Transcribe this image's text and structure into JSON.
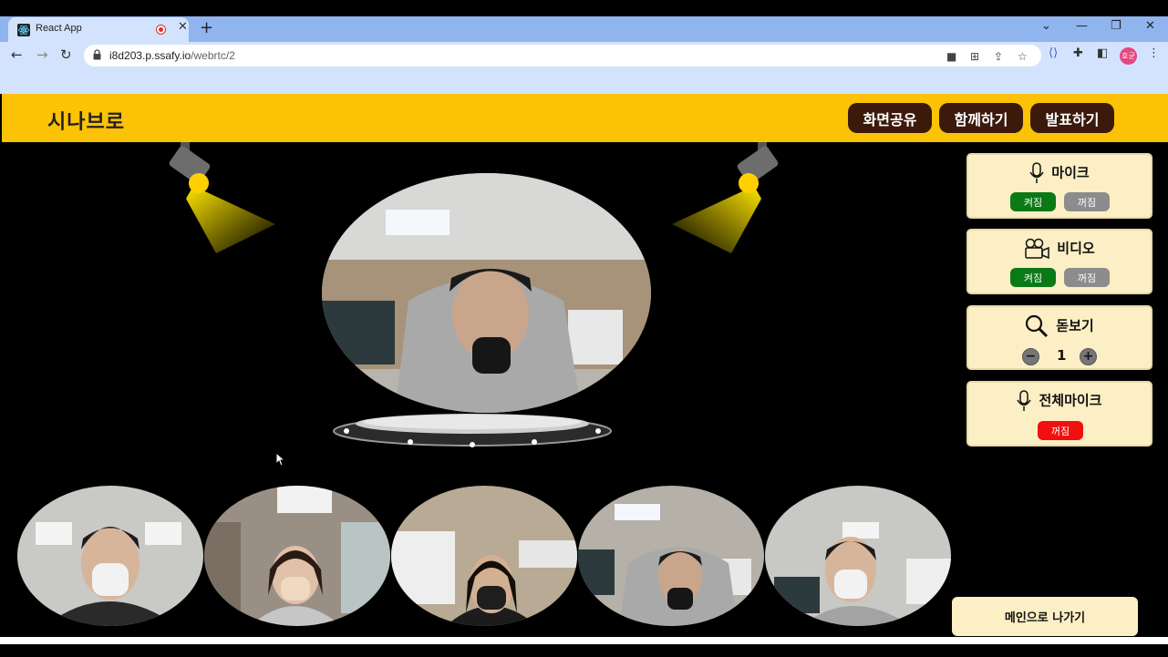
{
  "browser": {
    "tab_title": "React App",
    "url_host": "i8d203.p.ssafy.io",
    "url_path": "/webrtc/2",
    "profile_initials": "호균"
  },
  "app": {
    "logo": "시나브로",
    "header_buttons": [
      "화면공유",
      "함께하기",
      "발표하기"
    ],
    "controls": {
      "mic": {
        "title": "마이크",
        "on": "켜짐",
        "off": "꺼짐"
      },
      "video": {
        "title": "비디오",
        "on": "켜짐",
        "off": "꺼짐"
      },
      "zoom": {
        "title": "돋보기",
        "value": "1",
        "minus": "−",
        "plus": "+"
      },
      "all_mic": {
        "title": "전체마이크",
        "state": "꺼짐"
      }
    },
    "exit_label": "메인으로 나가기",
    "colors": {
      "header": "#fcc206",
      "header_button": "#3b1a0c",
      "panel": "#fcefc5",
      "on": "#0b7a16",
      "off": "#8c8c8c",
      "danger": "#f20f0f"
    },
    "participants": [
      "participant-1",
      "participant-2",
      "participant-3",
      "participant-4",
      "participant-5"
    ]
  }
}
